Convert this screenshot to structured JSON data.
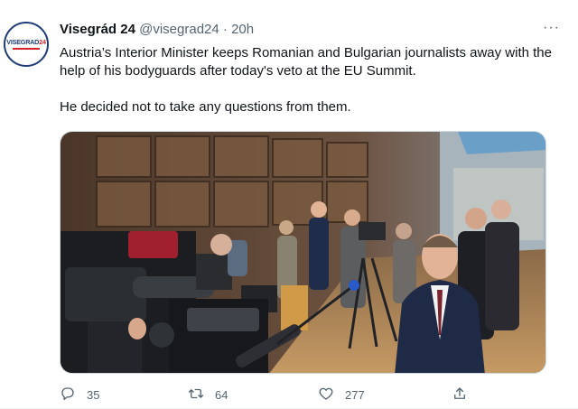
{
  "tweet": {
    "avatar_logo_text": "VISEGRAD",
    "avatar_logo_highlight": "24",
    "display_name": "Visegrád 24",
    "handle": "@visegrad24",
    "separator": "·",
    "time": "20h",
    "more_label": "···",
    "text_line1": "Austria’s Interior Minister keeps Romanian and Bulgarian journalists  away with the help of his bodyguards after today's veto at the EU Summit.",
    "text_line2": "He decided not to take any questions from them.",
    "actions": {
      "reply_count": "35",
      "retweet_count": "64",
      "like_count": "277"
    }
  },
  "icons": {
    "reply": "reply-icon",
    "retweet": "retweet-icon",
    "like": "like-icon",
    "share": "share-icon",
    "more": "more-icon"
  },
  "colors": {
    "text_primary": "#0f1419",
    "text_secondary": "#536471",
    "logo_blue": "#1d3c78",
    "logo_red": "#d4232a"
  }
}
